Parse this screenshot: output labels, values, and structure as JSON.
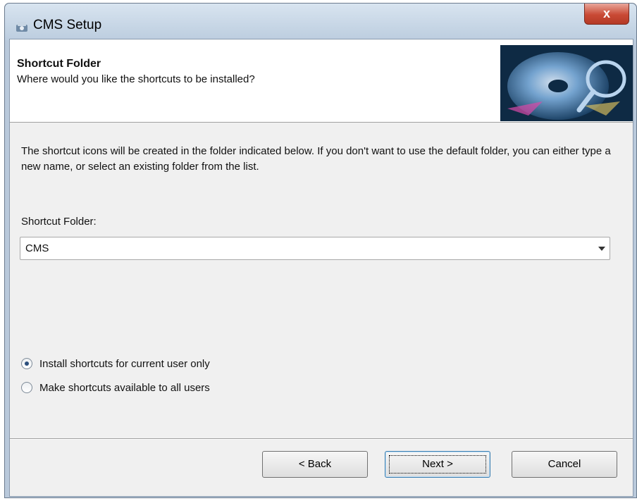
{
  "window": {
    "title": "CMS Setup",
    "close_label": "x",
    "accent_close_color": "#c94a35"
  },
  "header": {
    "title": "Shortcut Folder",
    "subtitle": "Where would you like the shortcuts to be installed?"
  },
  "body": {
    "description": "The shortcut icons will be created in the folder indicated below. If you don't want to use the default folder, you can either type a new name, or select an existing folder from the list.",
    "folder_label": "Shortcut Folder:",
    "folder_value": "CMS"
  },
  "options": {
    "current_user_label": "Install shortcuts for current user only",
    "all_users_label": "Make shortcuts available to all users",
    "selected": "current_user"
  },
  "buttons": {
    "back": "< Back",
    "next": "Next >",
    "cancel": "Cancel"
  }
}
